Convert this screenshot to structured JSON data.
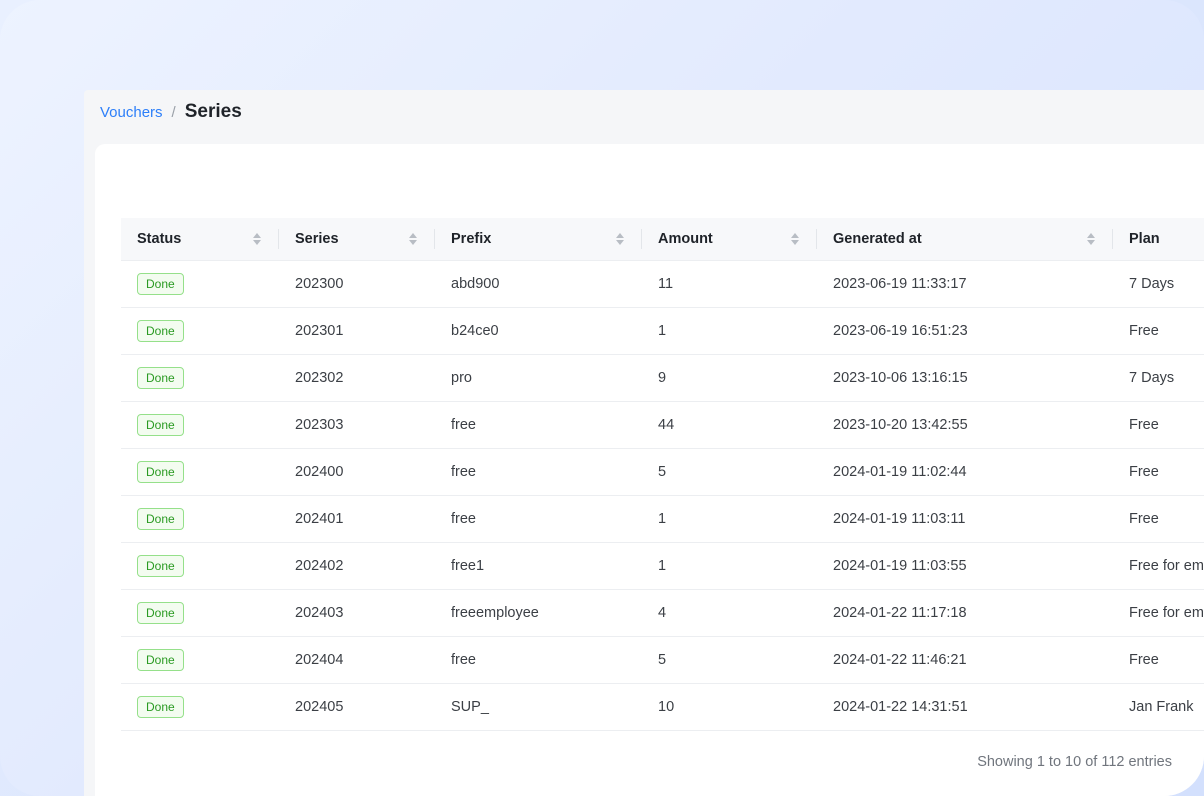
{
  "breadcrumb": {
    "parent": "Vouchers",
    "separator": "/",
    "current": "Series"
  },
  "table": {
    "columns": [
      "Status",
      "Series",
      "Prefix",
      "Amount",
      "Generated at",
      "Plan"
    ],
    "rows": [
      {
        "status": "Done",
        "series": "202300",
        "prefix": "abd900",
        "amount": "11",
        "generated_at": "2023-06-19 11:33:17",
        "plan": "7 Days"
      },
      {
        "status": "Done",
        "series": "202301",
        "prefix": "b24ce0",
        "amount": "1",
        "generated_at": "2023-06-19 16:51:23",
        "plan": "Free"
      },
      {
        "status": "Done",
        "series": "202302",
        "prefix": "pro",
        "amount": "9",
        "generated_at": "2023-10-06 13:16:15",
        "plan": "7 Days"
      },
      {
        "status": "Done",
        "series": "202303",
        "prefix": "free",
        "amount": "44",
        "generated_at": "2023-10-20 13:42:55",
        "plan": "Free"
      },
      {
        "status": "Done",
        "series": "202400",
        "prefix": "free",
        "amount": "5",
        "generated_at": "2024-01-19 11:02:44",
        "plan": "Free"
      },
      {
        "status": "Done",
        "series": "202401",
        "prefix": "free",
        "amount": "1",
        "generated_at": "2024-01-19 11:03:11",
        "plan": "Free"
      },
      {
        "status": "Done",
        "series": "202402",
        "prefix": "free1",
        "amount": "1",
        "generated_at": "2024-01-19 11:03:55",
        "plan": "Free for em"
      },
      {
        "status": "Done",
        "series": "202403",
        "prefix": "freeemployee",
        "amount": "4",
        "generated_at": "2024-01-22 11:17:18",
        "plan": "Free for em"
      },
      {
        "status": "Done",
        "series": "202404",
        "prefix": "free",
        "amount": "5",
        "generated_at": "2024-01-22 11:46:21",
        "plan": "Free"
      },
      {
        "status": "Done",
        "series": "202405",
        "prefix": "SUP_",
        "amount": "10",
        "generated_at": "2024-01-22 14:31:51",
        "plan": "Jan Frank"
      }
    ]
  },
  "pagination": {
    "summary": "Showing 1 to 10 of 112 entries"
  },
  "colors": {
    "link": "#2d7ff9",
    "badge_border": "#95e08a",
    "badge_text": "#2a9a22",
    "header_bg": "#f7f8fa"
  }
}
